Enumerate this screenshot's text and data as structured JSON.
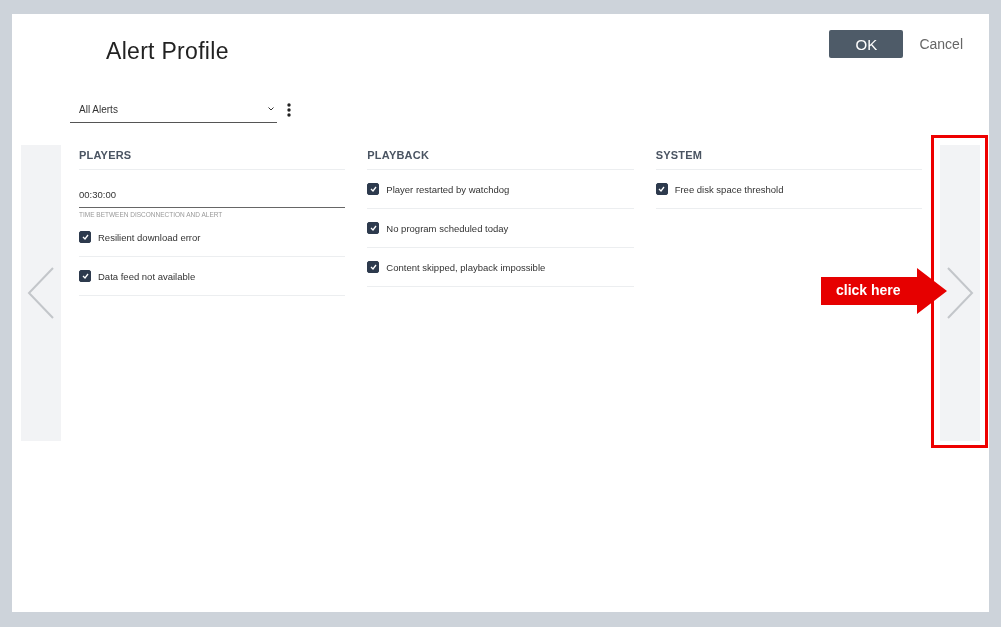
{
  "dialog": {
    "title": "Alert Profile",
    "buttons": [
      {
        "label": "OK",
        "kind": "primary"
      },
      {
        "label": "Cancel",
        "kind": "link"
      }
    ]
  },
  "filter": {
    "value": "All Alerts"
  },
  "columns": [
    {
      "heading": "PLAYERS",
      "items": [
        {
          "kind": "field",
          "value": "00:30:00",
          "helper": "TIME BETWEEN DISCONNECTION AND ALERT"
        },
        {
          "kind": "checkbox",
          "label": "Resilient download error",
          "checked": true
        },
        {
          "kind": "checkbox",
          "label": "Data feed not available",
          "checked": true
        }
      ]
    },
    {
      "heading": "PLAYBACK",
      "items": [
        {
          "kind": "checkbox",
          "label": "Player restarted by watchdog",
          "checked": true
        },
        {
          "kind": "checkbox",
          "label": "No program scheduled today",
          "checked": true
        },
        {
          "kind": "checkbox",
          "label": "Content skipped, playback impossible",
          "checked": true
        }
      ]
    },
    {
      "heading": "SYSTEM",
      "items": [
        {
          "kind": "checkbox",
          "label": "Free disk space threshold",
          "checked": true
        }
      ]
    }
  ],
  "annotation": {
    "label": "click here"
  }
}
